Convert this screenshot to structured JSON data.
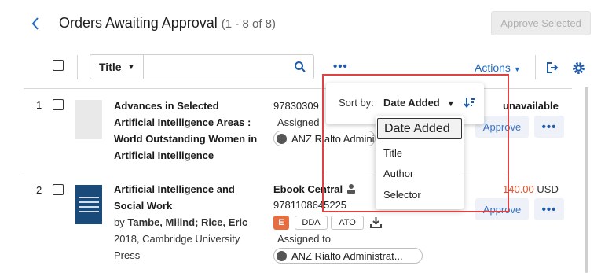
{
  "header": {
    "title": "Orders Awaiting Approval",
    "count": "(1 - 8 of 8)",
    "approve_selected": "Approve Selected"
  },
  "toolbar": {
    "search_field": "Title",
    "search_value": "",
    "more_label": "•••",
    "actions_label": "Actions"
  },
  "sort": {
    "label": "Sort by:",
    "value": "Date Added",
    "options": [
      "Date Added",
      "Title",
      "Author",
      "Selector"
    ]
  },
  "rows": [
    {
      "number": "1",
      "title_lines": [
        "Advances in Selected",
        "Artificial Intelligence Areas :",
        "World Outstanding Women in",
        "Artificial Intelligence"
      ],
      "isbn": "97830309",
      "assigned_label": "Assigned",
      "assignee": "ANZ Rialto Admini",
      "status": "unavailable",
      "approve_label": "Approve"
    },
    {
      "number": "2",
      "title_lines": [
        "Artificial Intelligence and",
        "Social Work"
      ],
      "by_label": "by",
      "authors": "Tambe, Milind; Rice, Eric",
      "year_publisher": "2018, Cambridge University",
      "publisher_line2": "Press",
      "vendor": "Ebook Central",
      "isbn": "9781108645225",
      "tags": [
        "E",
        "DDA",
        "ATO"
      ],
      "assigned_label": "Assigned to",
      "assignee": "ANZ Rialto Administrat...",
      "price": "140.00",
      "currency": "USD",
      "approve_label": "Approve"
    }
  ],
  "colors": {
    "accent": "#1f6bbf",
    "highlight_border": "#e04141",
    "price": "#e0512a",
    "format_tag": "#e56f43"
  }
}
